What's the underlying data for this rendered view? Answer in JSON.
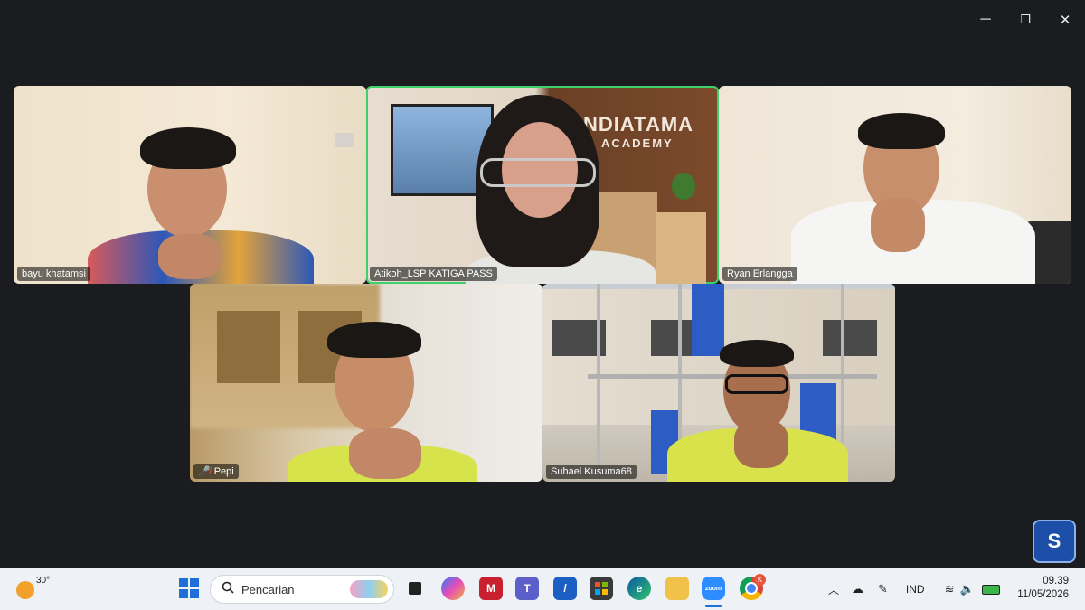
{
  "window_controls": {
    "minimize": "─",
    "restore": "❐",
    "close": "✕"
  },
  "participants": [
    {
      "name": "bayu khatamsi",
      "muted": false,
      "active": false
    },
    {
      "name": "Atikoh_LSP KATIGA PASS",
      "muted": false,
      "active": true
    },
    {
      "name": "Ryan Erlangga",
      "muted": false,
      "active": false
    },
    {
      "name": "Pepi",
      "muted": true,
      "active": false
    },
    {
      "name": "Suhael Kusuma68",
      "muted": false,
      "active": false
    }
  ],
  "background_sign": {
    "line1": "NDIATAMA",
    "line2": "ACADEMY"
  },
  "taskbar": {
    "weather_temp": "30°",
    "search_placeholder": "Pencarian",
    "zoom_label": "zoom",
    "chrome_badge": "K",
    "language": "IND",
    "time": "09.39",
    "date": "11/05/2026"
  },
  "colors": {
    "active_speaker": "#3dd06b",
    "background": "#1a1c1f",
    "taskbar": "#eef1f6"
  }
}
